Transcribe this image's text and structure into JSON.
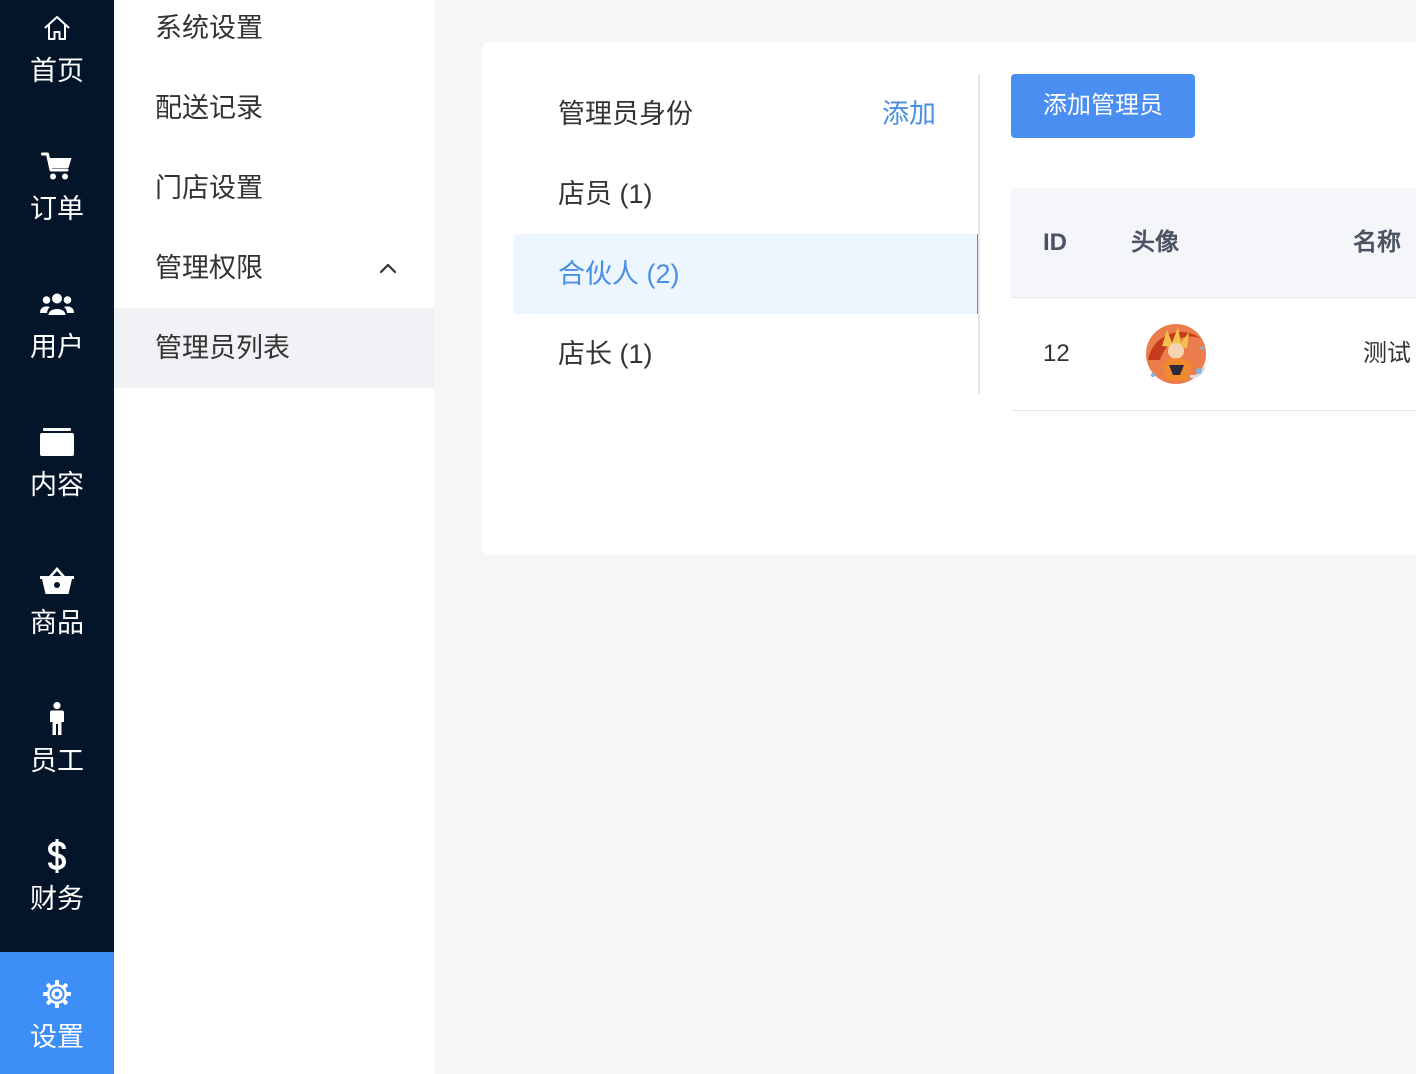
{
  "theme": {
    "nav_background": "#041529",
    "nav_active": "#3e8ef7",
    "primary": "#4a8fe6",
    "button": "#4b8ef1",
    "page_background": "#f5f6f8"
  },
  "nav": {
    "items": [
      {
        "label": "首页",
        "icon": "home-icon",
        "active": false
      },
      {
        "label": "订单",
        "icon": "cart-icon",
        "active": false
      },
      {
        "label": "用户",
        "icon": "users-icon",
        "active": false
      },
      {
        "label": "内容",
        "icon": "folder-icon",
        "active": false
      },
      {
        "label": "商品",
        "icon": "basket-icon",
        "active": false
      },
      {
        "label": "员工",
        "icon": "person-icon",
        "active": false
      },
      {
        "label": "财务",
        "icon": "dollar-icon",
        "active": false
      },
      {
        "label": "设置",
        "icon": "gear-icon",
        "active": true
      }
    ]
  },
  "submenu": {
    "items": [
      {
        "label": "系统设置",
        "active": false
      },
      {
        "label": "配送记录",
        "active": false
      },
      {
        "label": "门店设置",
        "active": false
      },
      {
        "label": "管理权限",
        "active": false,
        "expanded": true,
        "icon": "chevron-up-icon"
      },
      {
        "label": "管理员列表",
        "active": true
      }
    ]
  },
  "roles": {
    "title": "管理员身份",
    "add_label": "添加",
    "items": [
      {
        "label": "店员 (1)",
        "active": false
      },
      {
        "label": "合伙人 (2)",
        "active": true
      },
      {
        "label": "店长 (1)",
        "active": false
      }
    ]
  },
  "admins": {
    "add_button_label": "添加管理员",
    "columns": {
      "id": "ID",
      "avatar": "头像",
      "name": "名称"
    },
    "rows": [
      {
        "id": "12",
        "name": "测试"
      }
    ]
  }
}
